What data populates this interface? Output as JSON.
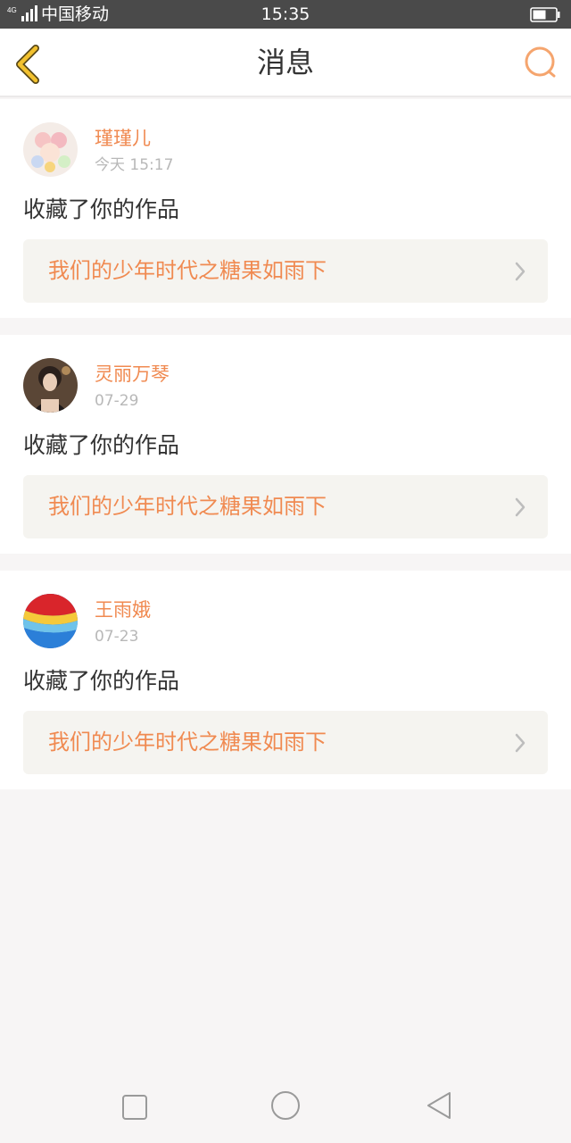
{
  "status_bar": {
    "network": "4G",
    "carrier": "中国移动",
    "time": "15:35"
  },
  "header": {
    "title": "消息",
    "back_icon": "chevron-left-icon",
    "search_icon": "search-icon"
  },
  "colors": {
    "accent": "#f08a51",
    "back_icon": "#f2c12e",
    "background": "#f7f5f5",
    "link_card": "#f5f4f0"
  },
  "notifications": [
    {
      "user": "瑾瑾儿",
      "time": "今天 15:17",
      "action": "收藏了你的作品",
      "work_title": "我们的少年时代之糖果如雨下"
    },
    {
      "user": "灵丽万琴",
      "time": "07-29",
      "action": "收藏了你的作品",
      "work_title": "我们的少年时代之糖果如雨下"
    },
    {
      "user": "王雨娥",
      "time": "07-23",
      "action": "收藏了你的作品",
      "work_title": "我们的少年时代之糖果如雨下"
    }
  ],
  "nav_bar": {
    "buttons": [
      "recent-apps-icon",
      "home-icon",
      "back-triangle-icon"
    ]
  }
}
